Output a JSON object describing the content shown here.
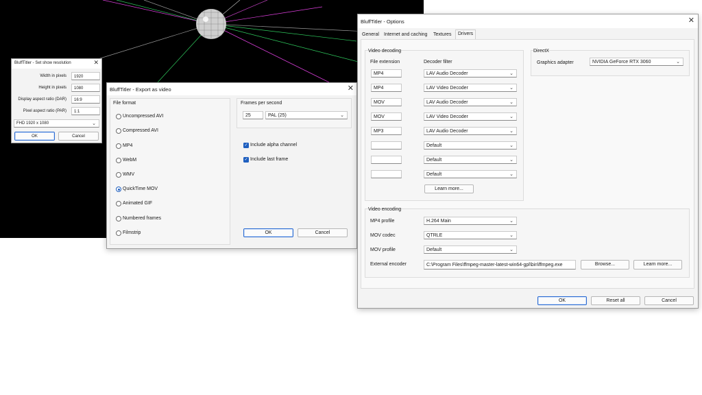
{
  "resolution_dialog": {
    "title": "BluffTitler - Set show resolution",
    "rows": [
      {
        "label": "Width in pixels",
        "value": "1920"
      },
      {
        "label": "Height in pixels",
        "value": "1080"
      },
      {
        "label": "Display aspect ratio (DAR)",
        "value": "16:9"
      },
      {
        "label": "Pixel aspect ratio (PAR)",
        "value": "1:1"
      }
    ],
    "preset": "FHD 1920 x 1080",
    "ok_label": "OK",
    "cancel_label": "Cancel"
  },
  "export_dialog": {
    "title": "BluffTitler - Export as video",
    "file_format_label": "File format",
    "formats": [
      {
        "label": "Uncompressed AVI",
        "selected": false
      },
      {
        "label": "Compressed AVI",
        "selected": false
      },
      {
        "label": "MP4",
        "selected": false
      },
      {
        "label": "WebM",
        "selected": false
      },
      {
        "label": "WMV",
        "selected": false
      },
      {
        "label": "QuickTime MOV",
        "selected": true
      },
      {
        "label": "Animated GIF",
        "selected": false
      },
      {
        "label": "Numbered frames",
        "selected": false
      },
      {
        "label": "Filmstrip",
        "selected": false
      }
    ],
    "fps_label": "Frames per second",
    "fps_value": "25",
    "fps_preset": "PAL (25)",
    "include_alpha_label": "Include alpha channel",
    "include_last_frame_label": "Include last frame",
    "ok_label": "OK",
    "cancel_label": "Cancel"
  },
  "options_dialog": {
    "title": "BluffTitler - Options",
    "tabs": [
      "General",
      "Internet and caching",
      "Textures",
      "Drivers"
    ],
    "active_tab": "Drivers",
    "video_decoding": {
      "label": "Video decoding",
      "ext_header": "File extension",
      "filter_header": "Decoder filter",
      "rows": [
        {
          "ext": "MP4",
          "filter": "LAV Audio Decoder"
        },
        {
          "ext": "MP4",
          "filter": "LAV Video Decoder"
        },
        {
          "ext": "MOV",
          "filter": "LAV Audio Decoder"
        },
        {
          "ext": "MOV",
          "filter": "LAV Video Decoder"
        },
        {
          "ext": "MP3",
          "filter": "LAV Audio Decoder"
        },
        {
          "ext": "",
          "filter": "Default"
        },
        {
          "ext": "",
          "filter": "Default"
        },
        {
          "ext": "",
          "filter": "Default"
        }
      ],
      "learn_more_label": "Learn more..."
    },
    "directx": {
      "label": "DirectX",
      "adapter_label": "Graphics adapter",
      "adapter_value": "NVIDIA GeForce RTX 3060"
    },
    "video_encoding": {
      "label": "Video encoding",
      "mp4_profile_label": "MP4 profile",
      "mp4_profile_value": "H.264 Main",
      "mov_codec_label": "MOV codec",
      "mov_codec_value": "QTRLE",
      "mov_profile_label": "MOV profile",
      "mov_profile_value": "Default",
      "external_encoder_label": "External encoder",
      "external_encoder_value": "C:\\Program Files\\ffmpeg-master-latest-win64-gpl\\bin\\ffmpeg.exe",
      "browse_label": "Browse...",
      "learn_more_label": "Learn more..."
    },
    "ok_label": "OK",
    "reset_label": "Reset all",
    "cancel_label": "Cancel"
  },
  "icons": {
    "close": "close-icon",
    "dropdown": "chevron-down-icon",
    "check": "checkmark-icon",
    "mirror_ball": "disco-ball-image"
  },
  "colors": {
    "accent": "#1f5fbf",
    "preview_bg": "#000000"
  }
}
